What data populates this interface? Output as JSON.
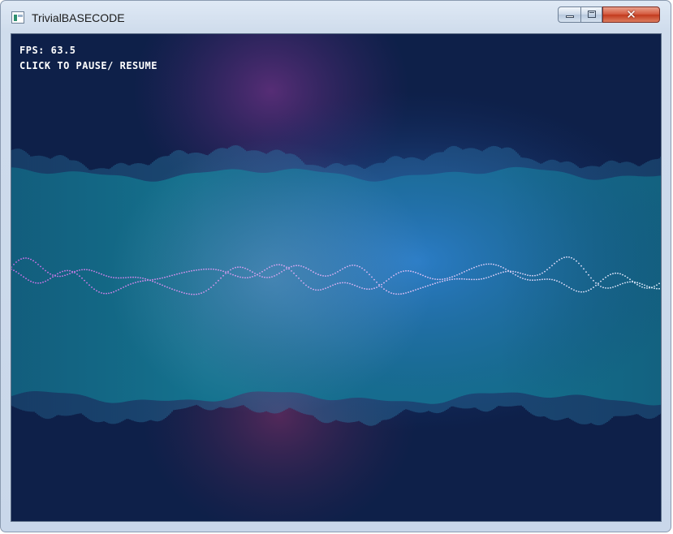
{
  "window": {
    "title": "TrivialBASECODE",
    "controls": {
      "minimize_icon": "minimize-icon",
      "maximize_icon": "maximize-icon",
      "close_icon": "close-icon",
      "close_glyph": "✕"
    }
  },
  "hud": {
    "fps_text": "FPS: 63.5",
    "instruction_text": "CLICK TO PAUSE/ RESUME"
  },
  "colors": {
    "background": "#0e2049",
    "band": "#14728e",
    "spikes": "#2a7aa6",
    "glow_center": "#2f7fd0",
    "glow_purple": "#5a2e78",
    "wave_left": "#d070e8",
    "wave_right": "#e6f2ff",
    "text": "#ffffff",
    "close_button": "#c23a1d"
  }
}
